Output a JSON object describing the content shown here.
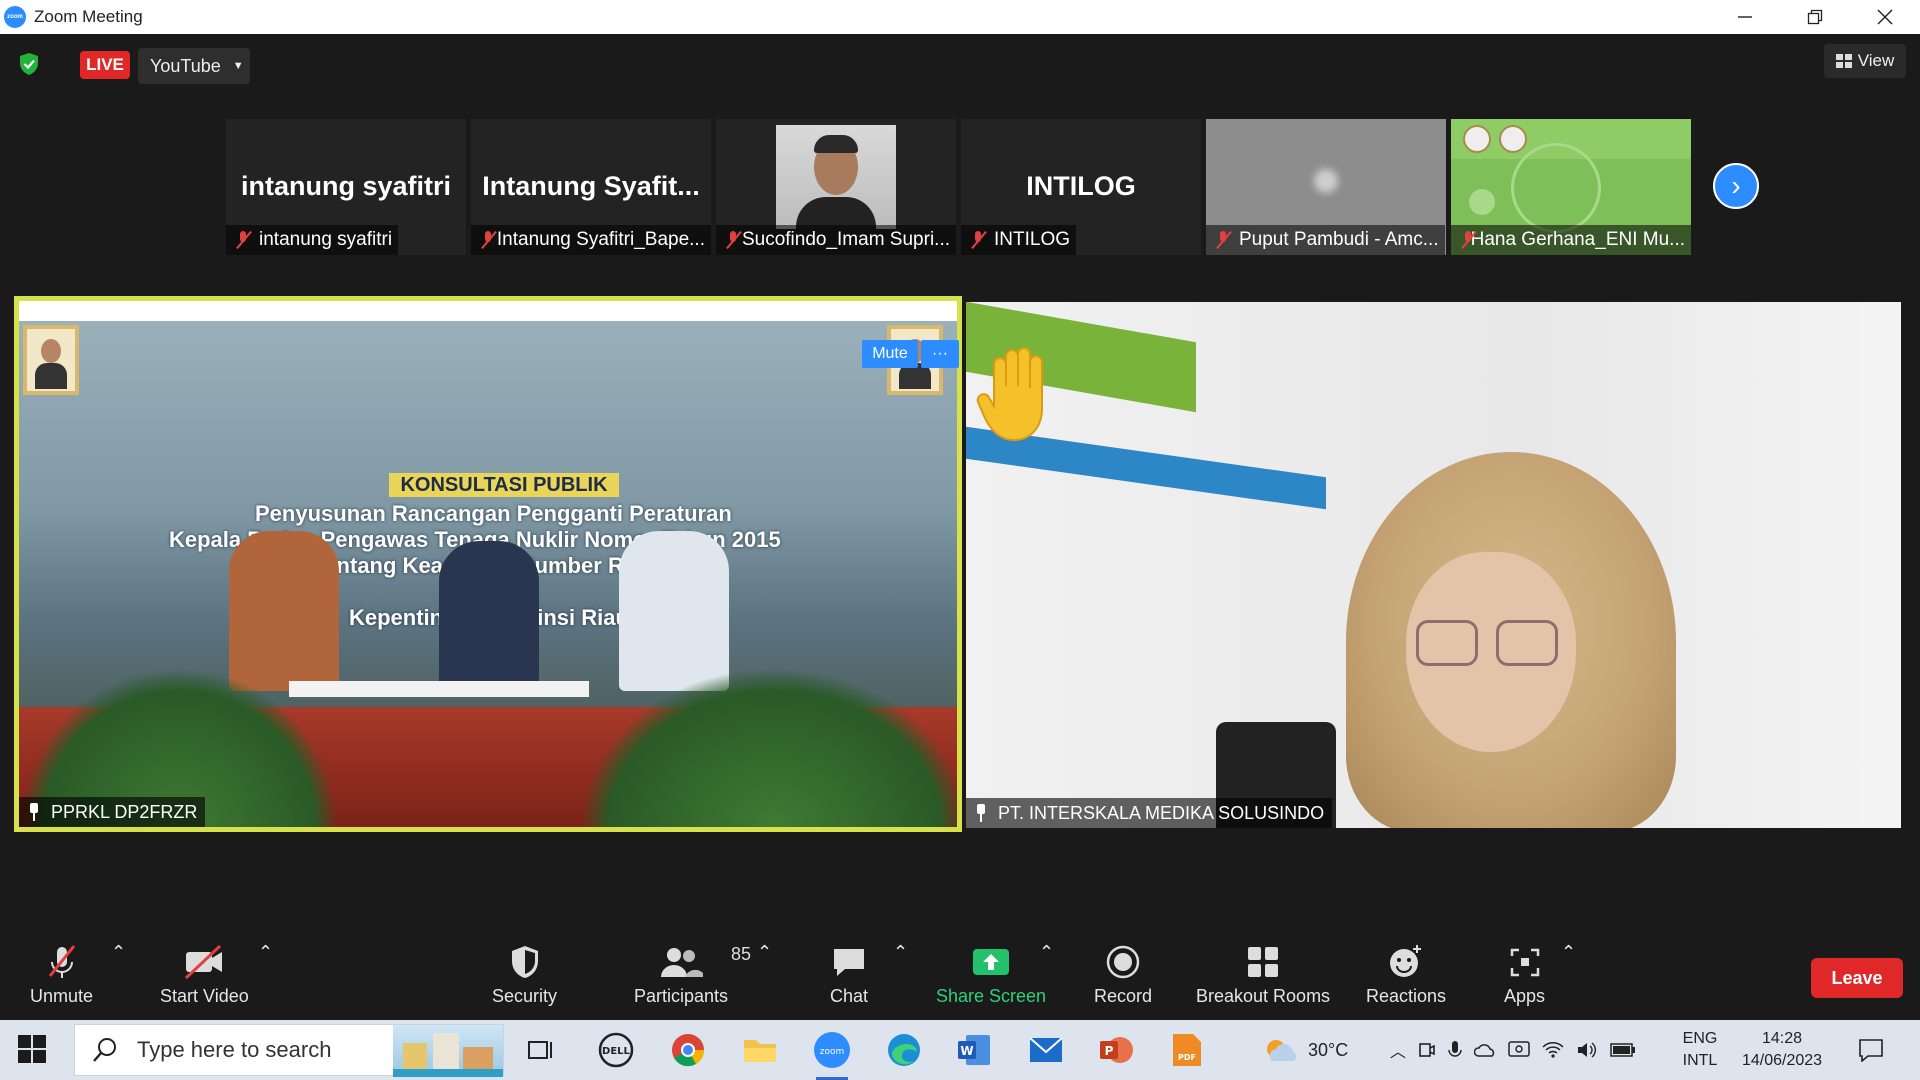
{
  "window": {
    "title": "Zoom Meeting",
    "controls": [
      "minimize",
      "restore",
      "close"
    ]
  },
  "topbar": {
    "live_label": "LIVE",
    "stream_target": "YouTube",
    "view_label": "View"
  },
  "thumbnails": [
    {
      "display": "intanung syafitri",
      "name": "intanung syafitri",
      "type": "name"
    },
    {
      "display": "Intanung  Syafit...",
      "name": "Intanung Syafitri_Bape...",
      "type": "name"
    },
    {
      "display": "",
      "name": "Sucofindo_Imam Supri...",
      "type": "video"
    },
    {
      "display": "INTILOG",
      "name": "INTILOG",
      "type": "name"
    },
    {
      "display": "",
      "name": "Puput Pambudi - Amc...",
      "type": "blurred"
    },
    {
      "display": "",
      "name": "Hana Gerhana_ENI Mu...",
      "type": "slide"
    }
  ],
  "main_videos": {
    "left": {
      "name": "PPRKL DP2FRZR",
      "mute_label": "Mute",
      "more_label": "···",
      "stage_title": "KONSULTASI PUBLIK",
      "stage_lines": [
        "Penyusunan Rancangan Pengganti Peraturan",
        "Kepala Badan Pengawas Tenaga Nuklir Nomor  Tahun 2015",
        "tentang Keamanan Sumber Radioaktif",
        "Kepentingan Provinsi Riau"
      ]
    },
    "right": {
      "name": "PT. INTERSKALA MEDIKA SOLUSINDO",
      "reaction": "raised-hand"
    }
  },
  "toolbar": {
    "unmute": "Unmute",
    "start_video": "Start Video",
    "security": "Security",
    "participants": "Participants",
    "participants_count": "85",
    "chat": "Chat",
    "share_screen": "Share Screen",
    "record": "Record",
    "breakout_rooms": "Breakout Rooms",
    "reactions": "Reactions",
    "apps": "Apps",
    "leave": "Leave"
  },
  "taskbar": {
    "search_placeholder": "Type here to search",
    "weather": "30°C",
    "lang_top": "ENG",
    "lang_bottom": "INTL",
    "time": "14:28",
    "date": "14/06/2023"
  },
  "colors": {
    "accent": "#2d8cff",
    "live_red": "#e02828",
    "share_green": "#2fd07a",
    "active_speaker_border": "#d7e24a"
  }
}
